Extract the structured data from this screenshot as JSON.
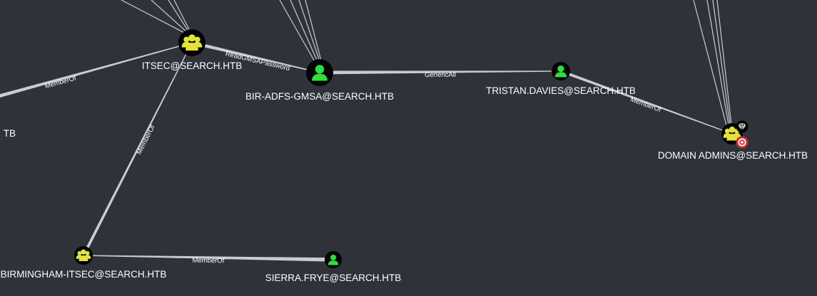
{
  "nodes": [
    {
      "id": "itsec",
      "kind": "group",
      "label": "ITSEC@SEARCH.HTB"
    },
    {
      "id": "gmsa",
      "kind": "user",
      "label": "BIR-ADFS-GMSA@SEARCH.HTB"
    },
    {
      "id": "tristan",
      "kind": "user",
      "label": "TRISTAN.DAVIES@SEARCH.HTB"
    },
    {
      "id": "domain_admins",
      "kind": "group",
      "label": "DOMAIN ADMINS@SEARCH.HTB",
      "badges": [
        "gem-icon",
        "target-icon"
      ]
    },
    {
      "id": "birmingham_itsec",
      "kind": "group",
      "label": "BIRMINGHAM-ITSEC@SEARCH.HTB"
    },
    {
      "id": "sierra",
      "kind": "user",
      "label": "SIERRA.FRYE@SEARCH.HTB"
    },
    {
      "id": "offscreen_left",
      "kind": "clipped",
      "label": "TB"
    }
  ],
  "edges": [
    {
      "from": "itsec",
      "to": "gmsa",
      "label": "ReadGMSAPassword"
    },
    {
      "from": "gmsa",
      "to": "tristan",
      "label": "GenericAll"
    },
    {
      "from": "tristan",
      "to": "domain_admins",
      "label": "MemberOf"
    },
    {
      "from": "birmingham_itsec",
      "to": "itsec",
      "label": "MemberOf"
    },
    {
      "from": "sierra",
      "to": "birmingham_itsec",
      "label": "MemberOf"
    },
    {
      "from": "offscreen_left",
      "to": "itsec",
      "label": "MemberOf"
    }
  ],
  "colors": {
    "background": "#2f3339",
    "group_icon": "#e3e33a",
    "user_icon": "#2fe03d",
    "node_disc": "#000000",
    "edge": "#c9cdd1",
    "label": "#ffffff",
    "target_badge": "#d42a2a"
  }
}
